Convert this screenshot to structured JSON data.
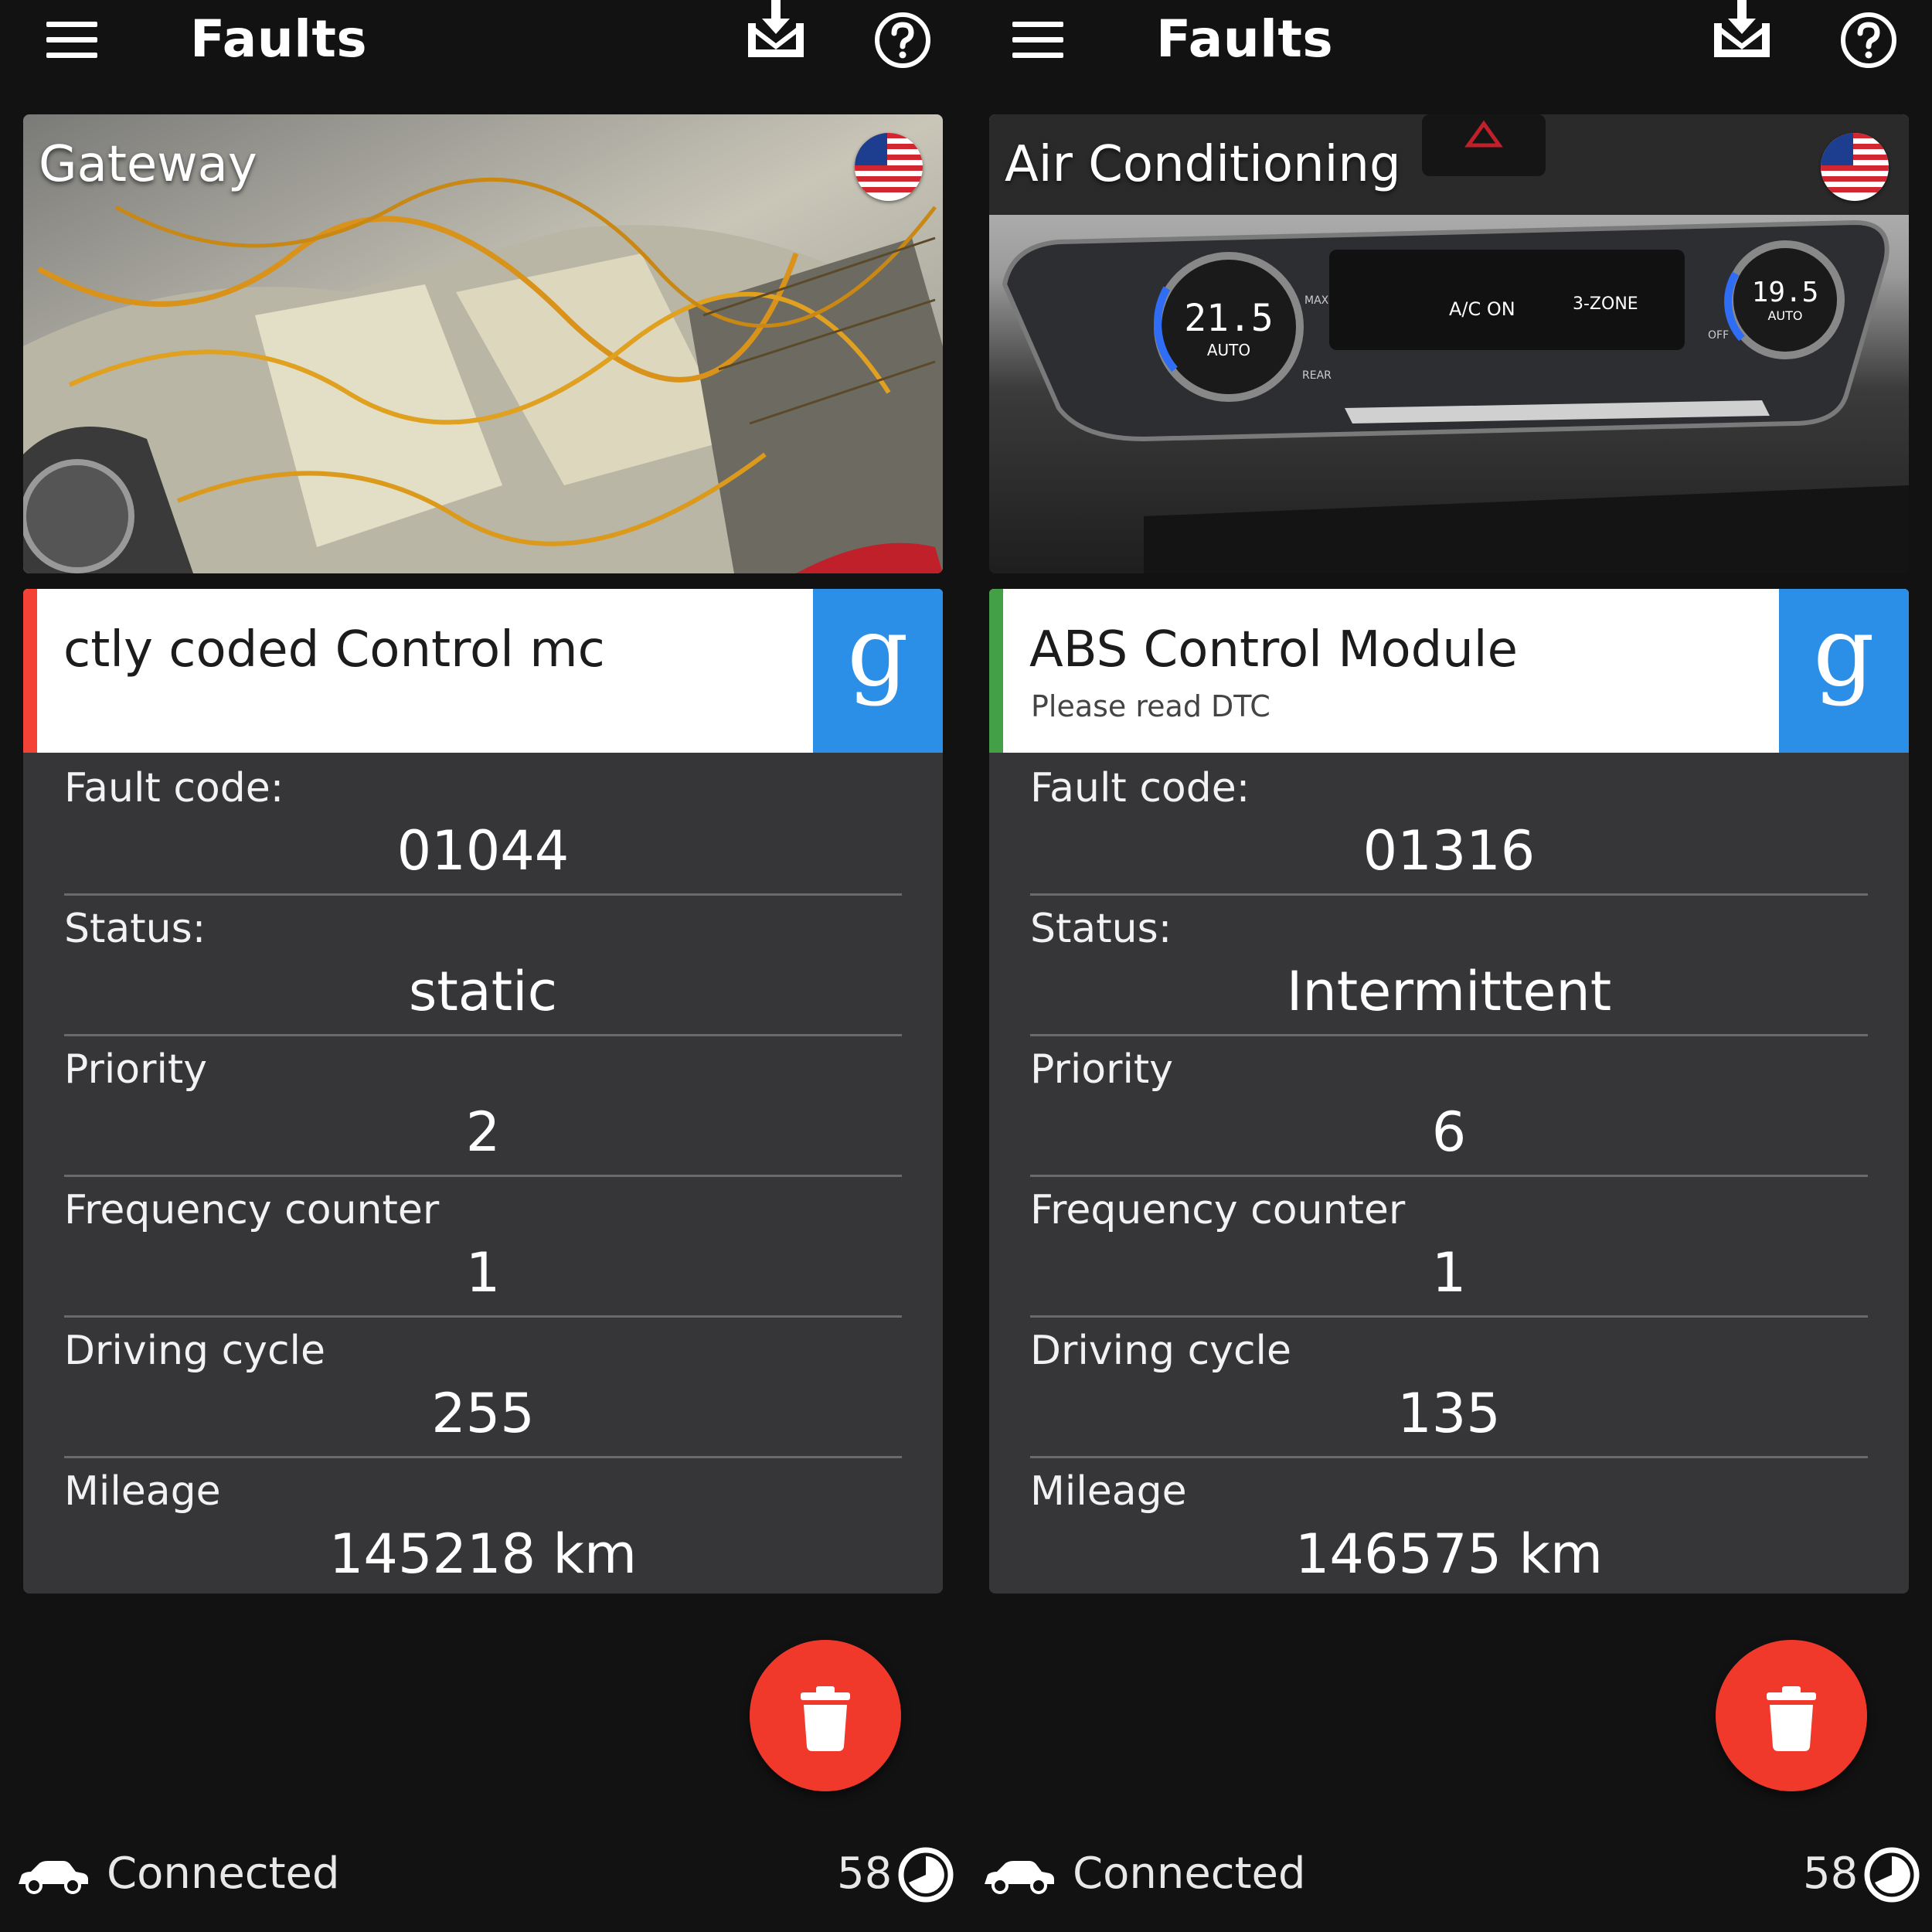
{
  "panels": [
    {
      "app_title": "Faults",
      "hero_title": "Gateway",
      "module_name": "ctly coded                       Control mc",
      "module_sub": "",
      "status_color": "#f44336",
      "fields": [
        {
          "label": "Fault code:",
          "value": "01044"
        },
        {
          "label": "Status:",
          "value": "static"
        },
        {
          "label": "Priority",
          "value": "2"
        },
        {
          "label": "Frequency counter",
          "value": "1"
        },
        {
          "label": "Driving cycle",
          "value": "255"
        },
        {
          "label": "Mileage",
          "value": "145218 km"
        }
      ],
      "connection": "Connected",
      "counter": "58"
    },
    {
      "app_title": "Faults",
      "hero_title": "Air Conditioning",
      "module_name": "ABS Control Module",
      "module_sub": "Please read DTC",
      "status_color": "#43a047",
      "fields": [
        {
          "label": "Fault code:",
          "value": "01316"
        },
        {
          "label": "Status:",
          "value": "Intermittent"
        },
        {
          "label": "Priority",
          "value": "6"
        },
        {
          "label": "Frequency counter",
          "value": "1"
        },
        {
          "label": "Driving cycle",
          "value": "135"
        },
        {
          "label": "Mileage",
          "value": "146575 km"
        }
      ],
      "connection": "Connected",
      "counter": "58"
    }
  ],
  "climate_display": {
    "left_temp": "21.5",
    "left_mode": "AUTO",
    "right_temp": "19.5",
    "right_mode": "AUTO",
    "ac_label": "A/C ON",
    "zone_label": "3-ZONE",
    "max_label": "MAX",
    "rear_label": "REAR",
    "off_label": "OFF"
  },
  "google_label": "g",
  "icons": {
    "menu": "menu-icon",
    "download": "mail-download-icon",
    "help": "help-circle-icon",
    "flag": "us-flag-icon",
    "delete": "trash-icon",
    "car": "car-icon",
    "speed": "speedometer-icon"
  },
  "colors": {
    "fab": "#f1392b",
    "google_button": "#2b8fe8",
    "card_bg": "#363638"
  }
}
